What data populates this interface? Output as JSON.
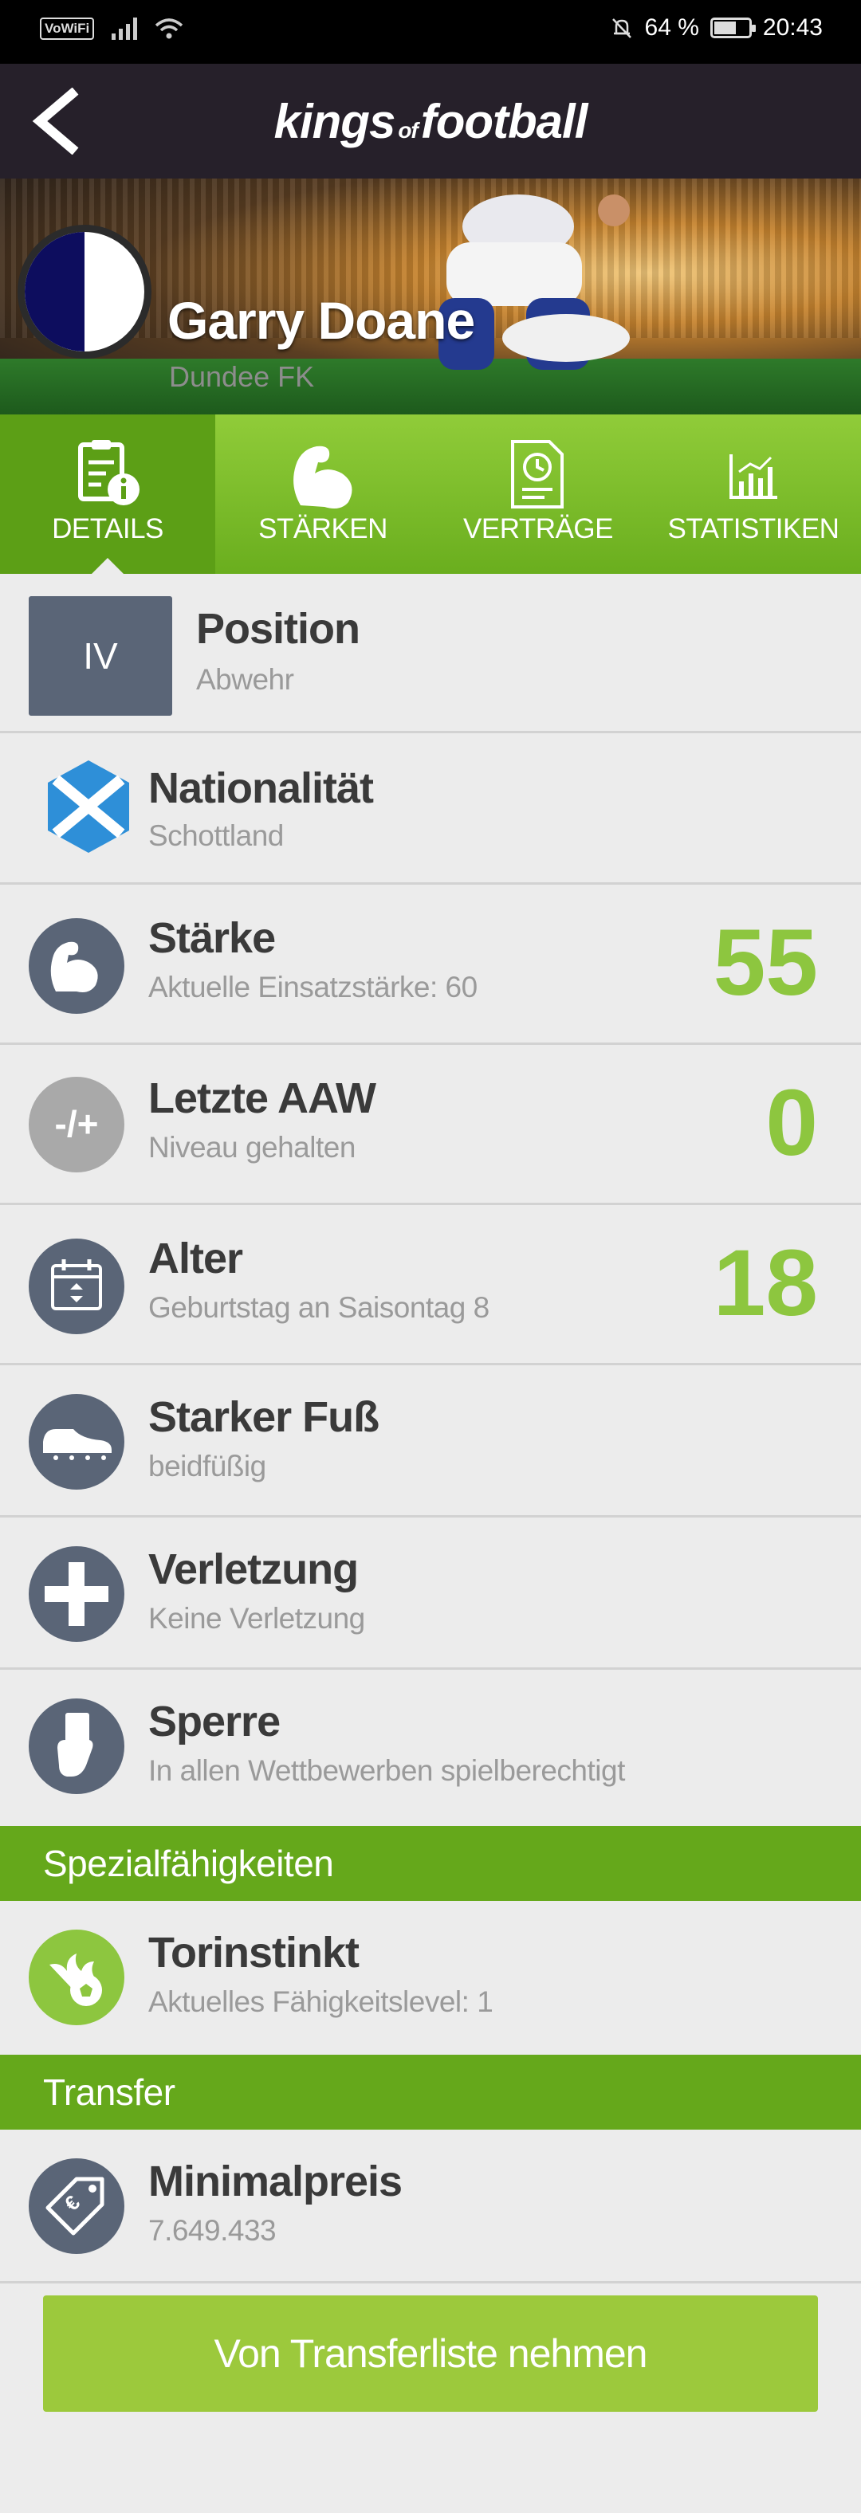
{
  "status_bar": {
    "network_label": "VoWiFi",
    "battery_percent": "64 %",
    "battery_level": 0.64,
    "time": "20:43"
  },
  "header": {
    "logo_main_1": "kings",
    "logo_of": "of",
    "logo_main_2": "football",
    "background_color": "#26202a"
  },
  "player": {
    "name": "Garry Doane",
    "club": "Dundee FK",
    "badge_colors": [
      "#0d0d5e",
      "#ffffff"
    ]
  },
  "tabs": [
    {
      "label": "DETAILS",
      "icon": "clipboard-info-icon",
      "active": true
    },
    {
      "label": "STÄRKEN",
      "icon": "biceps-icon",
      "active": false
    },
    {
      "label": "VERTRÄGE",
      "icon": "contract-clock-icon",
      "active": false
    },
    {
      "label": "STATISTIKEN",
      "icon": "bar-chart-icon",
      "active": false
    }
  ],
  "details": {
    "position": {
      "code": "IV",
      "title": "Position",
      "subtitle": "Abwehr"
    },
    "nationality": {
      "title": "Nationalität",
      "subtitle": "Schottland",
      "icon": "scotland-flag-icon"
    },
    "strength": {
      "title": "Stärke",
      "subtitle": "Aktuelle Einsatzstärke: 60",
      "value": "55",
      "icon": "biceps-icon"
    },
    "last_aaw": {
      "title": "Letzte AAW",
      "subtitle": "Niveau gehalten",
      "value": "0",
      "icon": "minus-plus-icon",
      "icon_text": "-/+"
    },
    "age": {
      "title": "Alter",
      "subtitle": "Geburtstag an Saisontag 8",
      "value": "18",
      "icon": "calendar-icon"
    },
    "strong_foot": {
      "title": "Starker Fuß",
      "subtitle": "beidfüßig",
      "icon": "football-boot-icon"
    },
    "injury": {
      "title": "Verletzung",
      "subtitle": "Keine Verletzung",
      "icon": "medical-cross-icon"
    },
    "suspension": {
      "title": "Sperre",
      "subtitle": "In allen Wettbewerben spielberechtigt",
      "icon": "referee-card-icon"
    }
  },
  "special_abilities": {
    "section_title": "Spezialfähigkeiten",
    "items": [
      {
        "title": "Torinstinkt",
        "subtitle": "Aktuelles Fähigkeitslevel: 1",
        "icon": "flaming-ball-icon"
      }
    ]
  },
  "transfer": {
    "section_title": "Transfer",
    "min_price_title": "Minimalpreis",
    "min_price_value": "7.649.433",
    "icon": "price-tag-icon",
    "button_label": "Von Transferliste nehmen"
  },
  "colors": {
    "accent_green": "#8dc63f",
    "tab_green": "#6aae1e",
    "section_green": "#65a81b",
    "icon_slate": "#5a6577",
    "button_green": "#9cc93c"
  }
}
